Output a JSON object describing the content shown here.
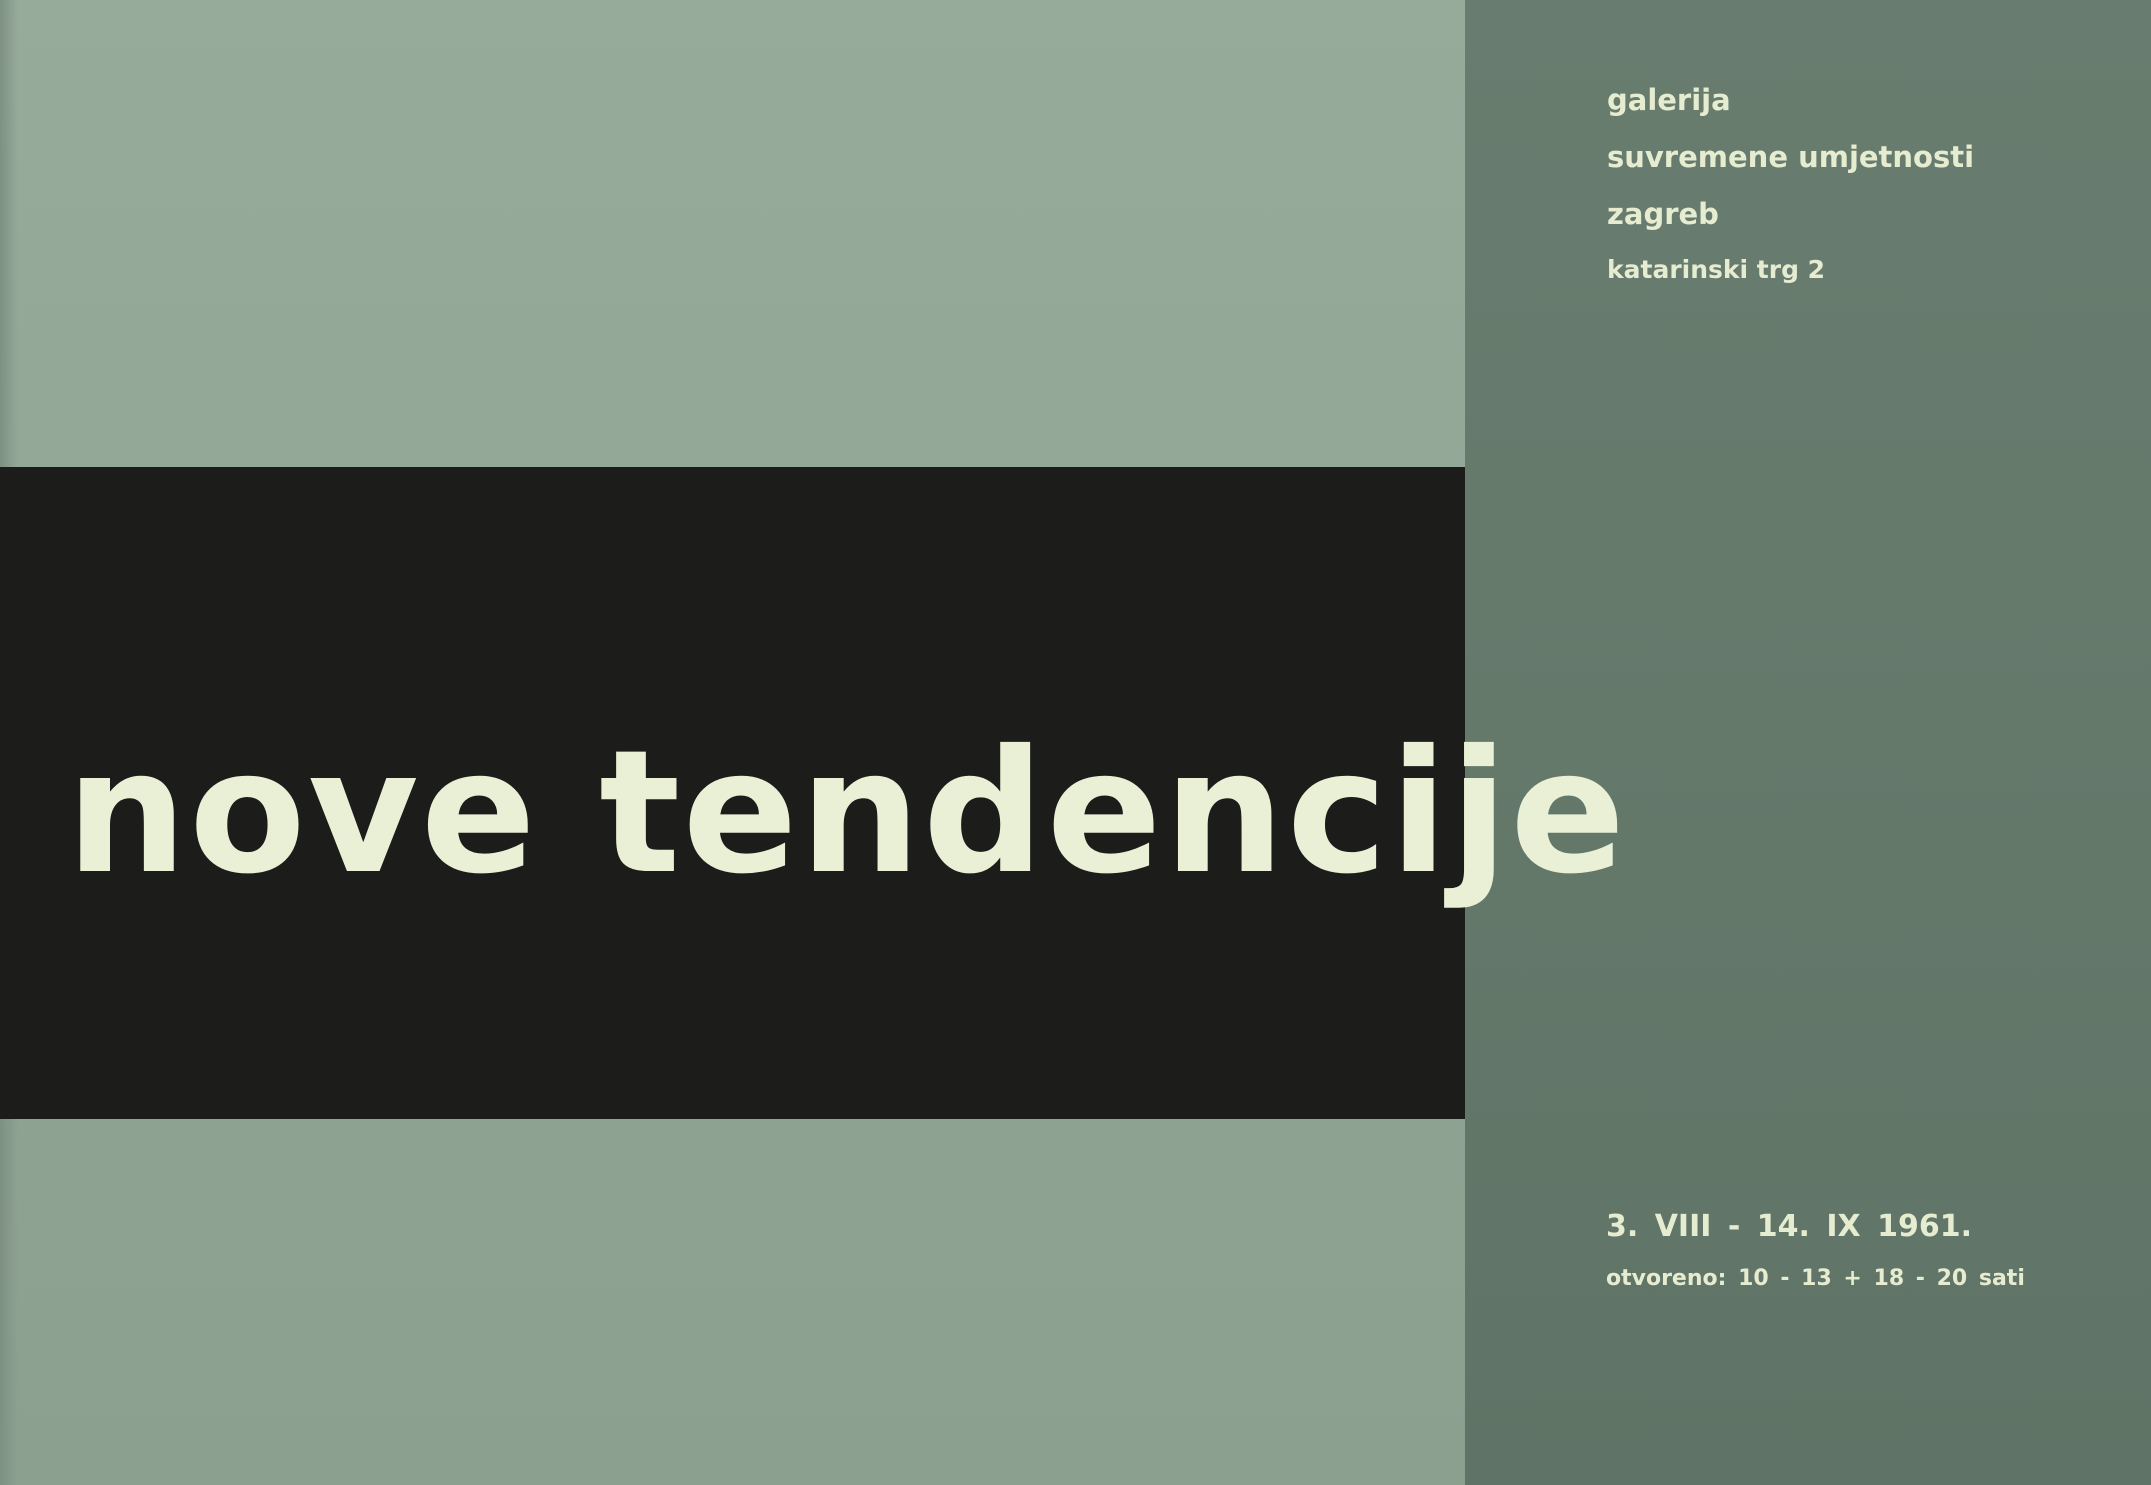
{
  "title": "nove tendencije",
  "gallery": {
    "name_line1": "galerija",
    "name_line2": "suvremene umjetnosti",
    "city": "zagreb",
    "address": "katarinski trg 2"
  },
  "exhibition": {
    "dates": "3. VIII - 14. IX 1961.",
    "opening_hours": "otvoreno: 10 - 13 + 18 - 20 sati"
  },
  "colors": {
    "left_panel": "#92a696",
    "right_panel": "#65796b",
    "band": "#1c1d1a",
    "text": "#e6ecd0"
  }
}
